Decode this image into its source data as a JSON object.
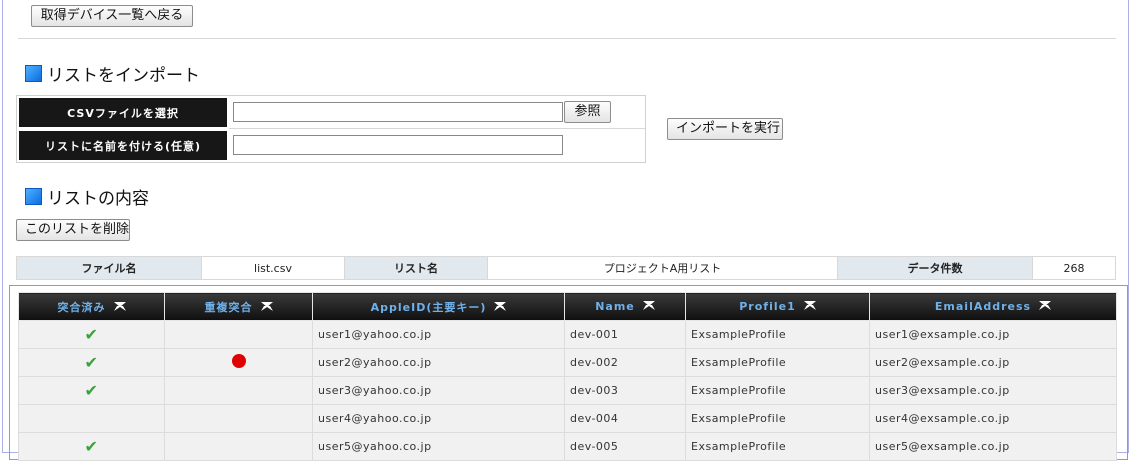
{
  "back_button_label": "取得デバイス一覧へ戻る",
  "import_section": {
    "title": "リストをインポート",
    "csv_label": "CSVファイルを選択",
    "browse_label": "参照",
    "name_label": "リストに名前を付ける(任意)",
    "csv_value": "",
    "name_value": "",
    "execute_label": "インポートを実行"
  },
  "content_section": {
    "title": "リストの内容",
    "delete_label": "このリストを削除"
  },
  "info": {
    "file_label": "ファイル名",
    "file_value": "list.csv",
    "list_label": "リスト名",
    "list_value": "プロジェクトA用リスト",
    "count_label": "データ件数",
    "count_value": "268"
  },
  "table": {
    "columns": [
      "突合済み",
      "重複突合",
      "AppleID(主要キー)",
      "Name",
      "Profile1",
      "EmailAddress"
    ],
    "rows": [
      {
        "matched": true,
        "duplicate": false,
        "apple_id": "user1@yahoo.co.jp",
        "name": "dev-001",
        "profile": "ExsampleProfile",
        "email": "user1@exsample.co.jp"
      },
      {
        "matched": true,
        "duplicate": true,
        "apple_id": "user2@yahoo.co.jp",
        "name": "dev-002",
        "profile": "ExsampleProfile",
        "email": "user2@exsample.co.jp"
      },
      {
        "matched": true,
        "duplicate": false,
        "apple_id": "user3@yahoo.co.jp",
        "name": "dev-003",
        "profile": "ExsampleProfile",
        "email": "user3@exsample.co.jp"
      },
      {
        "matched": false,
        "duplicate": false,
        "apple_id": "user4@yahoo.co.jp",
        "name": "dev-004",
        "profile": "ExsampleProfile",
        "email": "user4@exsample.co.jp"
      },
      {
        "matched": true,
        "duplicate": false,
        "apple_id": "user5@yahoo.co.jp",
        "name": "dev-005",
        "profile": "ExsampleProfile",
        "email": "user5@exsample.co.jp"
      }
    ]
  },
  "icons": {
    "check": "check-icon",
    "duplicate": "red-dot-icon",
    "sort": "sort-arrows-icon"
  },
  "colors": {
    "header_bg": "#171717",
    "header_text": "#6fb1ea",
    "check": "#3aa23a",
    "dot": "#e00000",
    "accent_square": "#1a86f0"
  }
}
